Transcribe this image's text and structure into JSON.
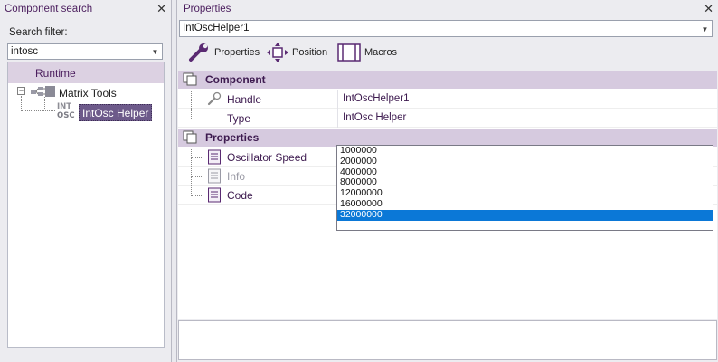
{
  "left_panel": {
    "title": "Component search",
    "close_glyph": "✕",
    "filter_label": "Search filter:",
    "filter_value": "intosc",
    "dropdown_glyph": "▼",
    "tree": {
      "root_label": "Runtime",
      "expander_glyph": "⊟",
      "group_label": "Matrix Tools",
      "item_icon_top": "INT",
      "item_icon_bottom": "OSC",
      "item_label": "IntOsc Helper"
    }
  },
  "right_panel": {
    "title": "Properties",
    "close_glyph": "✕",
    "object_selector_value": "IntOscHelper1",
    "dropdown_glyph": "▼",
    "toolbar": {
      "properties_label": "Properties",
      "position_label": "Position",
      "macros_label": "Macros"
    },
    "sections": {
      "component": {
        "title": "Component",
        "rows": [
          {
            "name": "Handle",
            "value": "IntOscHelper1"
          },
          {
            "name": "Type",
            "value": "IntOsc Helper"
          }
        ]
      },
      "properties": {
        "title": "Properties",
        "rows": [
          {
            "name": "Oscillator Speed"
          },
          {
            "name": "Info"
          },
          {
            "name": "Code"
          }
        ]
      }
    },
    "speed_options": [
      "1000000",
      "2000000",
      "4000000",
      "8000000",
      "12000000",
      "16000000",
      "32000000"
    ],
    "selected_speed": "32000000"
  },
  "colors": {
    "accent_purple": "#4b1e5e",
    "section_header": "#d6cadf",
    "selection_blue": "#0b78d7",
    "tree_selection": "#6d5a8a"
  }
}
